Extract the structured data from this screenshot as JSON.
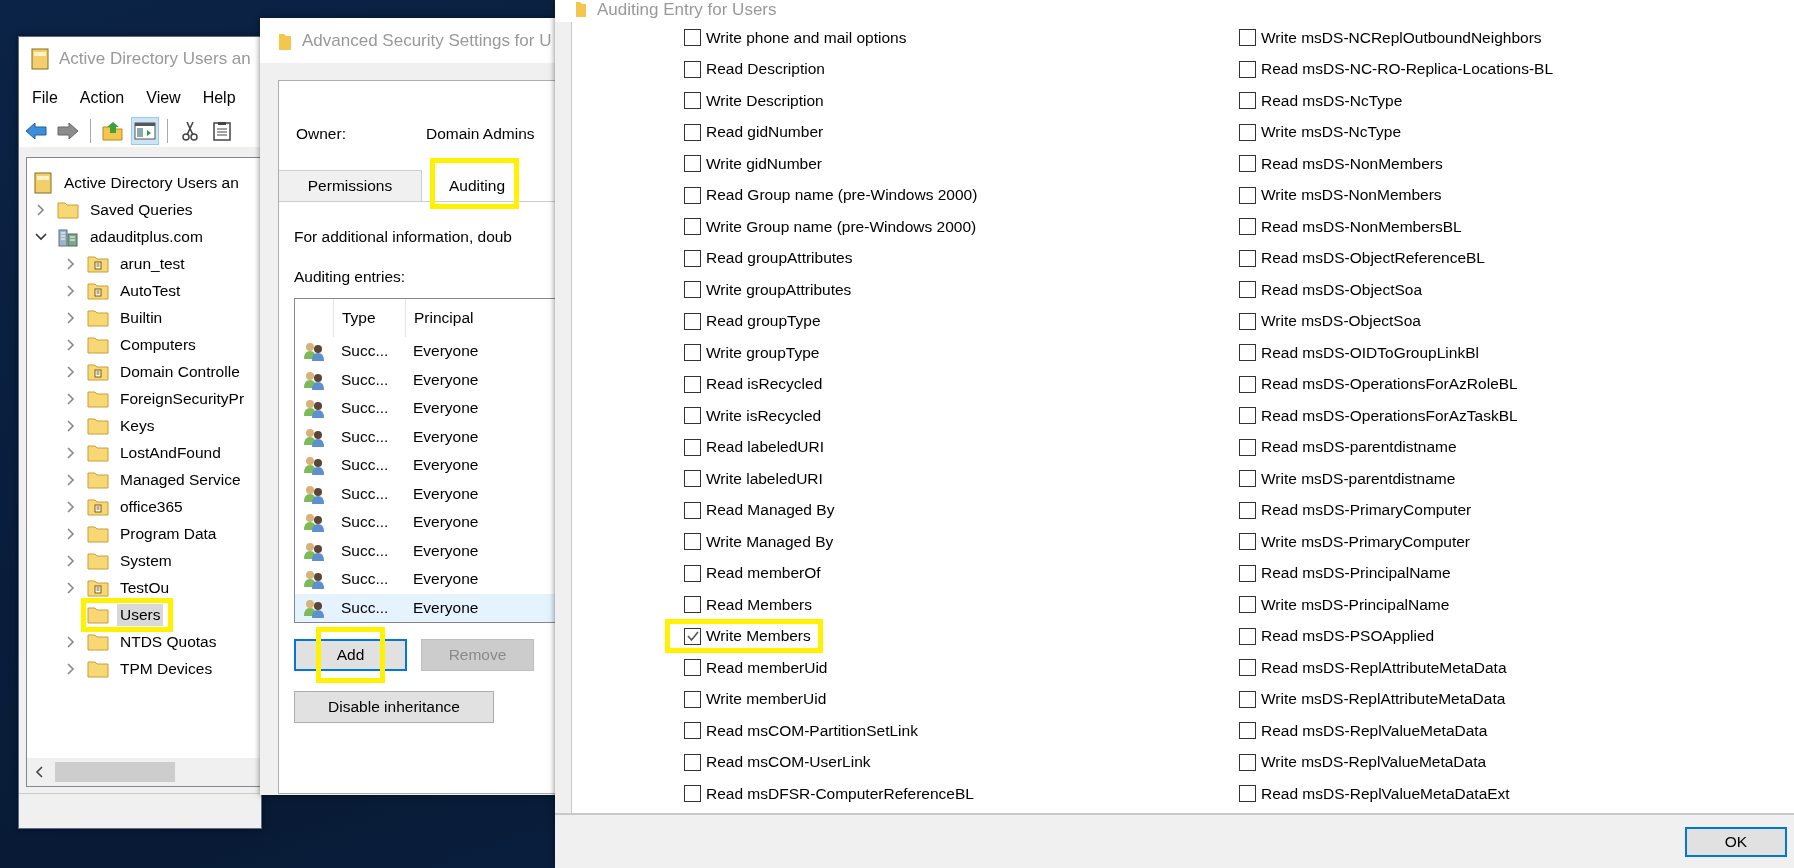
{
  "aduc_window": {
    "title": "Active Directory Users an",
    "menu": [
      "File",
      "Action",
      "View",
      "Help"
    ],
    "toolbar": [
      [
        {
          "kind": "back",
          "pressed": false
        },
        {
          "kind": "forward",
          "pressed": false
        }
      ],
      [
        {
          "kind": "up",
          "pressed": false
        },
        {
          "kind": "view",
          "pressed": true
        }
      ],
      [
        {
          "kind": "cut",
          "pressed": false
        },
        {
          "kind": "paste",
          "pressed": false
        }
      ]
    ],
    "tree": [
      {
        "label": "Active Directory Users an",
        "kind": "root",
        "selected": false,
        "highlighted": false,
        "children": [
          {
            "label": "Saved Queries",
            "kind": "folder",
            "expandable": true,
            "expanded": false,
            "selected": false,
            "highlighted": false
          },
          {
            "label": "adauditplus.com",
            "kind": "domain",
            "expandable": true,
            "expanded": true,
            "selected": false,
            "highlighted": false,
            "children": [
              {
                "label": "arun_test",
                "kind": "ou",
                "expandable": true,
                "expanded": false,
                "selected": false,
                "highlighted": false
              },
              {
                "label": "AutoTest",
                "kind": "ou",
                "expandable": true,
                "expanded": false,
                "selected": false,
                "highlighted": false
              },
              {
                "label": "Builtin",
                "kind": "folder",
                "expandable": true,
                "expanded": false,
                "selected": false,
                "highlighted": false
              },
              {
                "label": "Computers",
                "kind": "folder",
                "expandable": true,
                "expanded": false,
                "selected": false,
                "highlighted": false
              },
              {
                "label": "Domain Controlle",
                "kind": "ou",
                "expandable": true,
                "expanded": false,
                "selected": false,
                "highlighted": false
              },
              {
                "label": "ForeignSecurityPr",
                "kind": "folder",
                "expandable": true,
                "expanded": false,
                "selected": false,
                "highlighted": false
              },
              {
                "label": "Keys",
                "kind": "folder",
                "expandable": true,
                "expanded": false,
                "selected": false,
                "highlighted": false
              },
              {
                "label": "LostAndFound",
                "kind": "folder",
                "expandable": true,
                "expanded": false,
                "selected": false,
                "highlighted": false
              },
              {
                "label": "Managed Service",
                "kind": "folder",
                "expandable": true,
                "expanded": false,
                "selected": false,
                "highlighted": false
              },
              {
                "label": "office365",
                "kind": "ou",
                "expandable": true,
                "expanded": false,
                "selected": false,
                "highlighted": false
              },
              {
                "label": "Program Data",
                "kind": "folder",
                "expandable": true,
                "expanded": false,
                "selected": false,
                "highlighted": false
              },
              {
                "label": "System",
                "kind": "folder",
                "expandable": true,
                "expanded": false,
                "selected": false,
                "highlighted": false
              },
              {
                "label": "TestOu",
                "kind": "ou",
                "expandable": true,
                "expanded": false,
                "selected": false,
                "highlighted": false
              },
              {
                "label": "Users",
                "kind": "folder",
                "expandable": false,
                "selected": true,
                "highlighted": true
              },
              {
                "label": "NTDS Quotas",
                "kind": "folder",
                "expandable": true,
                "expanded": false,
                "selected": false,
                "highlighted": false
              },
              {
                "label": "TPM Devices",
                "kind": "folder",
                "expandable": true,
                "expanded": false,
                "selected": false,
                "highlighted": false
              }
            ]
          }
        ]
      }
    ]
  },
  "security_window": {
    "title": "Advanced Security Settings for U",
    "owner_label": "Owner:",
    "owner_value": "Domain Admins",
    "tabs": [
      {
        "label": "Permissions",
        "selected": false,
        "highlighted": false
      },
      {
        "label": "Auditing",
        "selected": true,
        "highlighted": true
      }
    ],
    "info_text": "For additional information, doub",
    "entries_label": "Auditing entries:",
    "table": {
      "columns": [
        "Type",
        "Principal"
      ],
      "rows": [
        {
          "type": "Succ...",
          "principal": "Everyone",
          "selected": false
        },
        {
          "type": "Succ...",
          "principal": "Everyone",
          "selected": false
        },
        {
          "type": "Succ...",
          "principal": "Everyone",
          "selected": false
        },
        {
          "type": "Succ...",
          "principal": "Everyone",
          "selected": false
        },
        {
          "type": "Succ...",
          "principal": "Everyone",
          "selected": false
        },
        {
          "type": "Succ...",
          "principal": "Everyone",
          "selected": false
        },
        {
          "type": "Succ...",
          "principal": "Everyone",
          "selected": false
        },
        {
          "type": "Succ...",
          "principal": "Everyone",
          "selected": false
        },
        {
          "type": "Succ...",
          "principal": "Everyone",
          "selected": false
        },
        {
          "type": "Succ...",
          "principal": "Everyone",
          "selected": true
        }
      ]
    },
    "buttons": [
      {
        "label": "Add",
        "focused": true,
        "disabled": false,
        "highlighted": true
      },
      {
        "label": "Remove",
        "focused": false,
        "disabled": true,
        "highlighted": false
      }
    ],
    "inheritance_button": "Disable inheritance"
  },
  "audit_entry_window": {
    "title": "Auditing Entry for Users",
    "permissions_left": [
      {
        "label": "Write phone and mail options",
        "checked": false,
        "highlighted": false
      },
      {
        "label": "Read Description",
        "checked": false,
        "highlighted": false
      },
      {
        "label": "Write Description",
        "checked": false,
        "highlighted": false
      },
      {
        "label": "Read gidNumber",
        "checked": false,
        "highlighted": false
      },
      {
        "label": "Write gidNumber",
        "checked": false,
        "highlighted": false
      },
      {
        "label": "Read Group name (pre-Windows 2000)",
        "checked": false,
        "highlighted": false
      },
      {
        "label": "Write Group name (pre-Windows 2000)",
        "checked": false,
        "highlighted": false
      },
      {
        "label": "Read groupAttributes",
        "checked": false,
        "highlighted": false
      },
      {
        "label": "Write groupAttributes",
        "checked": false,
        "highlighted": false
      },
      {
        "label": "Read groupType",
        "checked": false,
        "highlighted": false
      },
      {
        "label": "Write groupType",
        "checked": false,
        "highlighted": false
      },
      {
        "label": "Read isRecycled",
        "checked": false,
        "highlighted": false
      },
      {
        "label": "Write isRecycled",
        "checked": false,
        "highlighted": false
      },
      {
        "label": "Read labeledURI",
        "checked": false,
        "highlighted": false
      },
      {
        "label": "Write labeledURI",
        "checked": false,
        "highlighted": false
      },
      {
        "label": "Read Managed By",
        "checked": false,
        "highlighted": false
      },
      {
        "label": "Write Managed By",
        "checked": false,
        "highlighted": false
      },
      {
        "label": "Read memberOf",
        "checked": false,
        "highlighted": false
      },
      {
        "label": "Read Members",
        "checked": false,
        "highlighted": false
      },
      {
        "label": "Write Members",
        "checked": true,
        "highlighted": true
      },
      {
        "label": "Read memberUid",
        "checked": false,
        "highlighted": false
      },
      {
        "label": "Write memberUid",
        "checked": false,
        "highlighted": false
      },
      {
        "label": "Read msCOM-PartitionSetLink",
        "checked": false,
        "highlighted": false
      },
      {
        "label": "Read msCOM-UserLink",
        "checked": false,
        "highlighted": false
      },
      {
        "label": "Read msDFSR-ComputerReferenceBL",
        "checked": false,
        "highlighted": false
      }
    ],
    "permissions_right": [
      {
        "label": "Write msDS-NCReplOutboundNeighbors",
        "checked": false,
        "highlighted": false
      },
      {
        "label": "Read msDS-NC-RO-Replica-Locations-BL",
        "checked": false,
        "highlighted": false
      },
      {
        "label": "Read msDS-NcType",
        "checked": false,
        "highlighted": false
      },
      {
        "label": "Write msDS-NcType",
        "checked": false,
        "highlighted": false
      },
      {
        "label": "Read msDS-NonMembers",
        "checked": false,
        "highlighted": false
      },
      {
        "label": "Write msDS-NonMembers",
        "checked": false,
        "highlighted": false
      },
      {
        "label": "Read msDS-NonMembersBL",
        "checked": false,
        "highlighted": false
      },
      {
        "label": "Read msDS-ObjectReferenceBL",
        "checked": false,
        "highlighted": false
      },
      {
        "label": "Read msDS-ObjectSoa",
        "checked": false,
        "highlighted": false
      },
      {
        "label": "Write msDS-ObjectSoa",
        "checked": false,
        "highlighted": false
      },
      {
        "label": "Read msDS-OIDToGroupLinkBl",
        "checked": false,
        "highlighted": false
      },
      {
        "label": "Read msDS-OperationsForAzRoleBL",
        "checked": false,
        "highlighted": false
      },
      {
        "label": "Read msDS-OperationsForAzTaskBL",
        "checked": false,
        "highlighted": false
      },
      {
        "label": "Read msDS-parentdistname",
        "checked": false,
        "highlighted": false
      },
      {
        "label": "Write msDS-parentdistname",
        "checked": false,
        "highlighted": false
      },
      {
        "label": "Read msDS-PrimaryComputer",
        "checked": false,
        "highlighted": false
      },
      {
        "label": "Write msDS-PrimaryComputer",
        "checked": false,
        "highlighted": false
      },
      {
        "label": "Read msDS-PrincipalName",
        "checked": false,
        "highlighted": false
      },
      {
        "label": "Write msDS-PrincipalName",
        "checked": false,
        "highlighted": false
      },
      {
        "label": "Read msDS-PSOApplied",
        "checked": false,
        "highlighted": false
      },
      {
        "label": "Read msDS-ReplAttributeMetaData",
        "checked": false,
        "highlighted": false
      },
      {
        "label": "Write msDS-ReplAttributeMetaData",
        "checked": false,
        "highlighted": false
      },
      {
        "label": "Read msDS-ReplValueMetaData",
        "checked": false,
        "highlighted": false
      },
      {
        "label": "Write msDS-ReplValueMetaData",
        "checked": false,
        "highlighted": false
      },
      {
        "label": "Read msDS-ReplValueMetaDataExt",
        "checked": false,
        "highlighted": false
      }
    ],
    "ok_button": "OK"
  }
}
